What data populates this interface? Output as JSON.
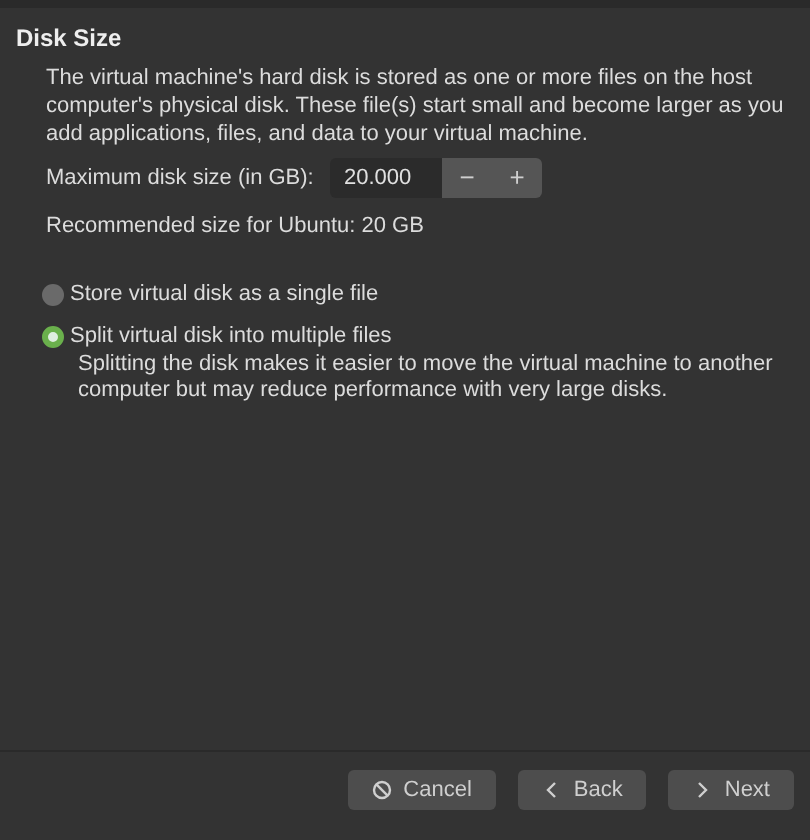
{
  "section": {
    "title": "Disk Size",
    "description": "The virtual machine's hard disk is stored as one or more files on the host computer's physical disk. These file(s) start small and become larger as you add applications, files, and data to your virtual machine.",
    "size_field": {
      "label": "Maximum disk size (in GB):",
      "value": "20.000",
      "decrement": "−",
      "increment": "+"
    },
    "recommendation": "Recommended size for Ubuntu: 20 GB",
    "options": [
      {
        "label": "Store virtual disk as a single file",
        "selected": false
      },
      {
        "label": "Split virtual disk into multiple files",
        "selected": true,
        "description": "Splitting the disk makes it easier to move the virtual machine to another computer but may reduce performance with very large disks."
      }
    ]
  },
  "buttons": [
    {
      "kind": "cancel",
      "label": "Cancel"
    },
    {
      "kind": "back",
      "label": "Back"
    },
    {
      "kind": "next",
      "label": "Next"
    }
  ]
}
